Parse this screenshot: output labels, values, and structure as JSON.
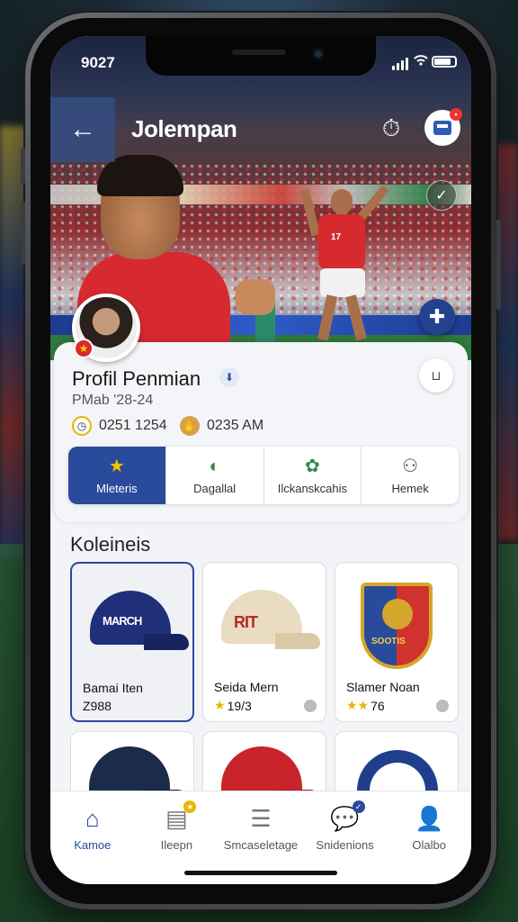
{
  "status_bar": {
    "time": "9027"
  },
  "header": {
    "title": "Jolempan"
  },
  "profile": {
    "name": "Profil Penmian",
    "meta": "PMab '28-24",
    "stats": [
      {
        "icon": "clock-icon",
        "value": "0251 1254"
      },
      {
        "icon": "hand-icon",
        "value": "0235 AM"
      }
    ]
  },
  "tabs": [
    {
      "label": "Mleteris",
      "icon": "star-icon",
      "active": true
    },
    {
      "label": "Dagallal",
      "icon": "leaf-icon",
      "active": false
    },
    {
      "label": "Ilckanskcahis",
      "icon": "group-icon",
      "active": false
    },
    {
      "label": "Hemek",
      "icon": "gamepad-icon",
      "active": false
    }
  ],
  "collection": {
    "title": "Koleineis",
    "items": [
      {
        "name": "Bamai Iten",
        "value": "Z988",
        "stars": "",
        "cap_text": "MARCH",
        "colors": {
          "crown": "#1f2f7a",
          "brim": "#17245f",
          "text": "#ffffff"
        }
      },
      {
        "name": "Seida Mern",
        "value": "19/3",
        "stars": "★",
        "cap_text": "RIT",
        "colors": {
          "crown": "#e9dcc0",
          "brim": "#d9c9a6",
          "text": "#b22a2a"
        }
      },
      {
        "name": "Slamer Noan",
        "value": "76",
        "stars": "★★",
        "cap_text": "SOOTIS",
        "colors": {
          "crown": "#2a4a9c",
          "brim": "#d0322e",
          "text": "#f3d04b"
        }
      }
    ]
  },
  "bottom_nav": [
    {
      "label": "Kamoe",
      "icon": "home-icon",
      "active": true
    },
    {
      "label": "Ileepn",
      "icon": "document-star-icon",
      "active": false
    },
    {
      "label": "Smcaseletage",
      "icon": "list-icon",
      "active": false
    },
    {
      "label": "Snidenions",
      "icon": "chat-icon",
      "active": false
    },
    {
      "label": "Olalbo",
      "icon": "user-icon",
      "active": false
    }
  ],
  "accent_color": "#2a4a9c"
}
